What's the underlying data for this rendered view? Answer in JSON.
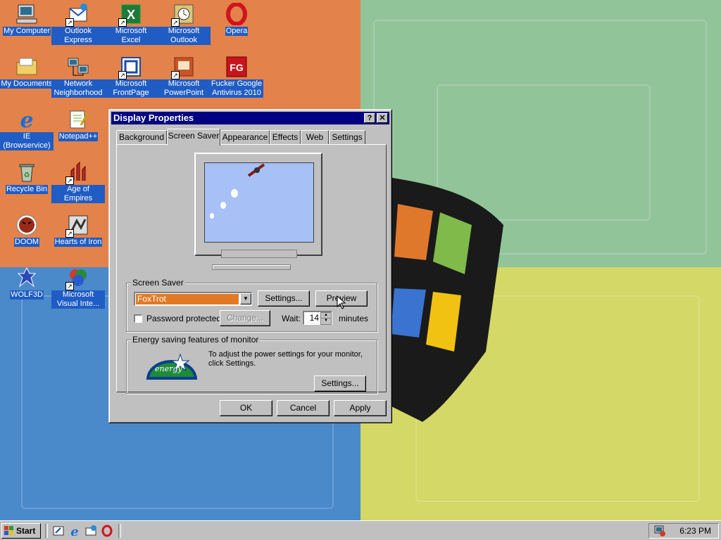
{
  "desktop": {
    "icons": [
      {
        "label": "My Computer"
      },
      {
        "label": "Outlook Express"
      },
      {
        "label": "Microsoft Excel"
      },
      {
        "label": "Microsoft Outlook"
      },
      {
        "label": "Opera"
      },
      {
        "label": "My Documents"
      },
      {
        "label": "Network Neighborhood"
      },
      {
        "label": "Microsoft FrontPage"
      },
      {
        "label": "Microsoft PowerPoint"
      },
      {
        "label": "Fucker Google Antivirus 2010"
      },
      {
        "label": "IE (Browservice)"
      },
      {
        "label": "Notepad++"
      },
      {
        "label": "Recycle Bin"
      },
      {
        "label": "Age of Empires"
      },
      {
        "label": "DOOM"
      },
      {
        "label": "Hearts of Iron"
      },
      {
        "label": "WOLF3D"
      },
      {
        "label": "Microsoft Visual Inte..."
      }
    ]
  },
  "window": {
    "title": "Display Properties",
    "help_glyph": "?",
    "close_glyph": "✕",
    "tabs": [
      {
        "label": "Background"
      },
      {
        "label": "Screen Saver"
      },
      {
        "label": "Appearance"
      },
      {
        "label": "Effects"
      },
      {
        "label": "Web"
      },
      {
        "label": "Settings"
      }
    ],
    "active_tab": "Screen Saver",
    "screensaver": {
      "group_title": "Screen Saver",
      "selected": "FoxTrot",
      "settings_label": "Settings...",
      "preview_label": "Preview",
      "password_label": "Password protected",
      "password_checked": false,
      "change_label": "Change...",
      "wait_label": "Wait:",
      "wait_value": "14",
      "minutes_label": "minutes"
    },
    "energy": {
      "group_title": "Energy saving features of monitor",
      "text": "To adjust the power settings for your monitor, click Settings.",
      "settings_label": "Settings...",
      "logo_text": "energy"
    },
    "buttons": {
      "ok": "OK",
      "cancel": "Cancel",
      "apply": "Apply"
    }
  },
  "taskbar": {
    "start_label": "Start",
    "clock": "6:23 PM"
  },
  "colors": {
    "titlebar": "#000080",
    "face": "#c0c0c0",
    "selection": "#e07a26",
    "desktop_label_bg": "#1f5cc4"
  }
}
